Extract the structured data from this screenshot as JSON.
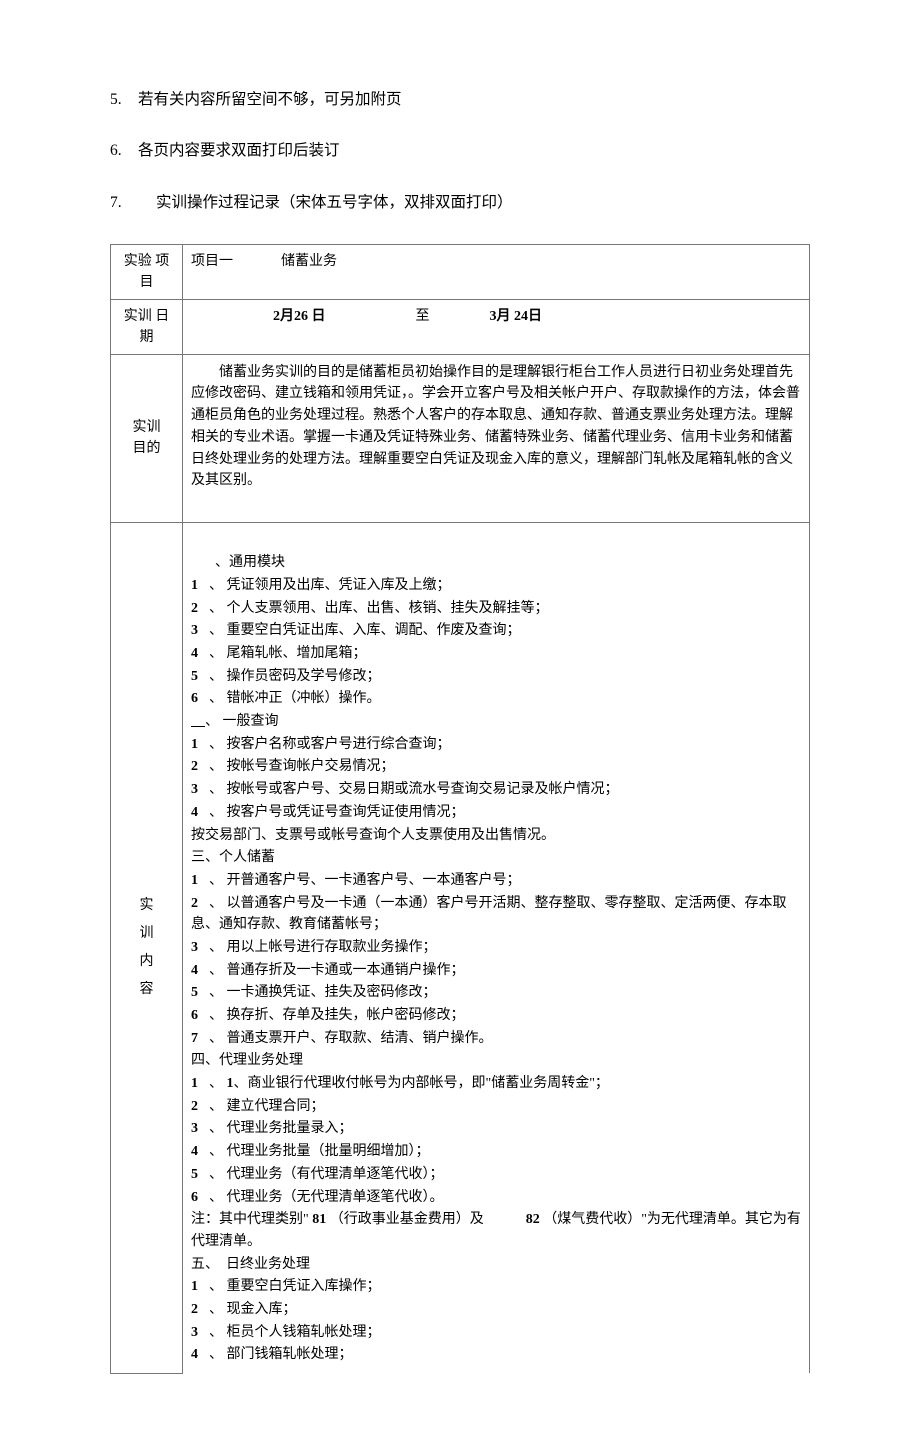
{
  "top": [
    {
      "n": "5.",
      "t": "若有关内容所留空间不够，可另加附页"
    },
    {
      "n": "6.",
      "t": "各页内容要求双面打印后装订"
    },
    {
      "n": "7.",
      "t": "实训操作过程记录（宋体五号字体，双排双面打印）",
      "wide": true
    }
  ],
  "tbl": {
    "r1l": "实验 项目",
    "r1a": "项目一",
    "r1b": "储蓄业务",
    "r2l": "实训 日期",
    "r2a": "2月26 日",
    "r2m": "至",
    "r2b": "3月 24日",
    "r3l1": "实训",
    "r3l2": "目的",
    "r3t": "储蓄业务实训的目的是储蓄柜员初始操作目的是理解银行柜台工作人员进行日初业务处理首先应修改密码、建立钱箱和领用凭证，。学会开立客户号及相关帐户开户、存取款操作的方法，体会普通柜员角色的业务处理过程。熟悉个人客户的存本取息、通知存款、普通支票业务处理方法。理解相关的专业术语。掌握一卡通及凭证特殊业务、储蓄特殊业务、储蓄代理业务、信用卡业务和储蓄日终处理业务的处理方法。理解重要空白凭证及现金入库的意义，理解部门轧帐及尾箱轧帐的含义及其区别。",
    "r4l1": "实",
    "r4l2": "训",
    "r4l3": "内",
    "r4l4": "容",
    "c": {
      "s1": "、通用模块",
      "s1i": [
        "凭证领用及出库、凭证入库及上缴；",
        "个人支票领用、出库、出售、核销、挂失及解挂等；",
        "重要空白凭证出库、入库、调配、作废及查询；",
        "尾箱轧帐、增加尾箱；",
        "操作员密码及学号修改；",
        "错帐冲正（冲帐）操作。"
      ],
      "s2": "、 一般查询",
      "s2i": [
        "按客户名称或客户号进行综合查询；",
        "按帐号查询帐户交易情况；",
        "按帐号或客户号、交易日期或流水号查询交易记录及帐户情况；",
        "按客户号或凭证号查询凭证使用情况；"
      ],
      "s2e": "按交易部门、支票号或帐号查询个人支票使用及出售情况。",
      "s3": "三、个人储蓄",
      "s3i": [
        "开普通客户号、一卡通客户号、一本通客户号；",
        "以普通客户号及一卡通（一本通）客户号开活期、整存整取、零存整取、定活两便、存本取息、通知存款、教育储蓄帐号；",
        "用以上帐号进行存取款业务操作；",
        "普通存折及一卡通或一本通销户操作；",
        "一卡通换凭证、挂失及密码修改；",
        "换存折、存单及挂失，帐户密码修改；",
        "普通支票开户、存取款、结清、销户操作。"
      ],
      "s4": "四、代理业务处理",
      "s4i1a": "1",
      "s4i1b": "、商业银行代理收付帐号为内部帐号，即\"储蓄业务周转金\"；",
      "s4i": [
        "建立代理合同；",
        "代理业务批量录入；",
        "代理业务批量（批量明细增加）；",
        "代理业务（有代理清单逐笔代收）；",
        "代理业务（无代理清单逐笔代收）。"
      ],
      "s4n1": "注：其中代理类别\" ",
      "s4n2": "81",
      "s4n3": "（行政事业基金费用）及",
      "s4n4": "82",
      "s4n5": "（煤气费代收）\"为无代理清单。其它为有代理清单。",
      "s5": "五、　日终业务处理",
      "s5i": [
        "重要空白凭证入库操作；",
        "现金入库；",
        "柜员个人钱箱轧帐处理；",
        "部门钱箱轧帐处理；"
      ]
    }
  }
}
